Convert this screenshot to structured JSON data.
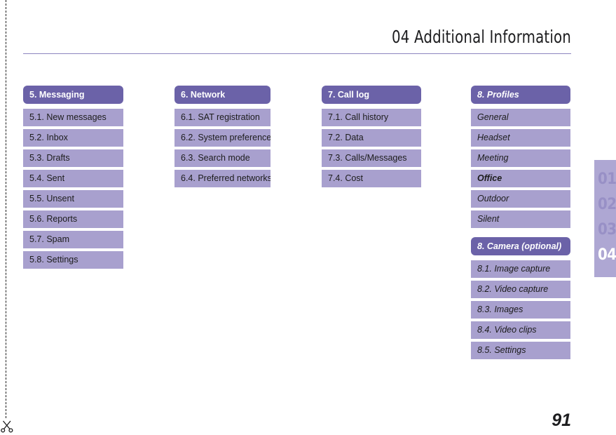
{
  "header": {
    "title": "04 Additional Information"
  },
  "columns": [
    {
      "id": "messaging-column",
      "groups": [
        {
          "id": "messaging",
          "header": "5.  Messaging",
          "style": "normal",
          "items": [
            {
              "label": "5.1. New messages",
              "emphasis": false
            },
            {
              "label": "5.2. Inbox",
              "emphasis": false
            },
            {
              "label": "5.3. Drafts",
              "emphasis": false
            },
            {
              "label": "5.4. Sent",
              "emphasis": false
            },
            {
              "label": "5.5. Unsent",
              "emphasis": false
            },
            {
              "label": "5.6. Reports",
              "emphasis": false
            },
            {
              "label": "5.7. Spam",
              "emphasis": false
            },
            {
              "label": "5.8. Settings",
              "emphasis": false
            }
          ]
        }
      ]
    },
    {
      "id": "network-column",
      "groups": [
        {
          "id": "network",
          "header": "6. Network",
          "style": "normal",
          "items": [
            {
              "label": "6.1. SAT registration",
              "emphasis": false
            },
            {
              "label": "6.2. System preference",
              "emphasis": false
            },
            {
              "label": "6.3. Search mode",
              "emphasis": false
            },
            {
              "label": "6.4. Preferred networks",
              "emphasis": false
            }
          ]
        }
      ]
    },
    {
      "id": "call-log-column",
      "groups": [
        {
          "id": "call-log",
          "header": "7. Call log",
          "style": "normal",
          "items": [
            {
              "label": "7.1. Call history",
              "emphasis": false
            },
            {
              "label": "7.2. Data",
              "emphasis": false
            },
            {
              "label": "7.3. Calls/Messages",
              "emphasis": false
            },
            {
              "label": "7.4. Cost",
              "emphasis": false
            }
          ]
        }
      ]
    },
    {
      "id": "profiles-column",
      "groups": [
        {
          "id": "profiles",
          "header": "8. Profiles",
          "style": "italic",
          "items": [
            {
              "label": "General",
              "emphasis": false
            },
            {
              "label": "Headset",
              "emphasis": false
            },
            {
              "label": "Meeting",
              "emphasis": false
            },
            {
              "label": "Office",
              "emphasis": true
            },
            {
              "label": "Outdoor",
              "emphasis": false
            },
            {
              "label": "Silent",
              "emphasis": false
            }
          ]
        },
        {
          "id": "camera",
          "header": "8. Camera (optional)",
          "style": "italic",
          "items": [
            {
              "label": "8.1. Image capture",
              "emphasis": false
            },
            {
              "label": "8.2. Video capture",
              "emphasis": false
            },
            {
              "label": "8.3. Images",
              "emphasis": false
            },
            {
              "label": "8.4. Video clips",
              "emphasis": false
            },
            {
              "label": "8.5. Settings",
              "emphasis": false
            }
          ]
        }
      ]
    }
  ],
  "chapter_tab": {
    "numbers": [
      "01",
      "02",
      "03",
      "04"
    ],
    "active": "04"
  },
  "page_number": "91",
  "colors": {
    "header_purple": "#6b62a8",
    "item_purple": "#a8a0ce",
    "tab_purple": "#aea7d3",
    "tab_inactive_text": "#9890c6",
    "rule": "#8c85bf"
  },
  "marks": {
    "cut_line_icon": "scissors-icon"
  }
}
